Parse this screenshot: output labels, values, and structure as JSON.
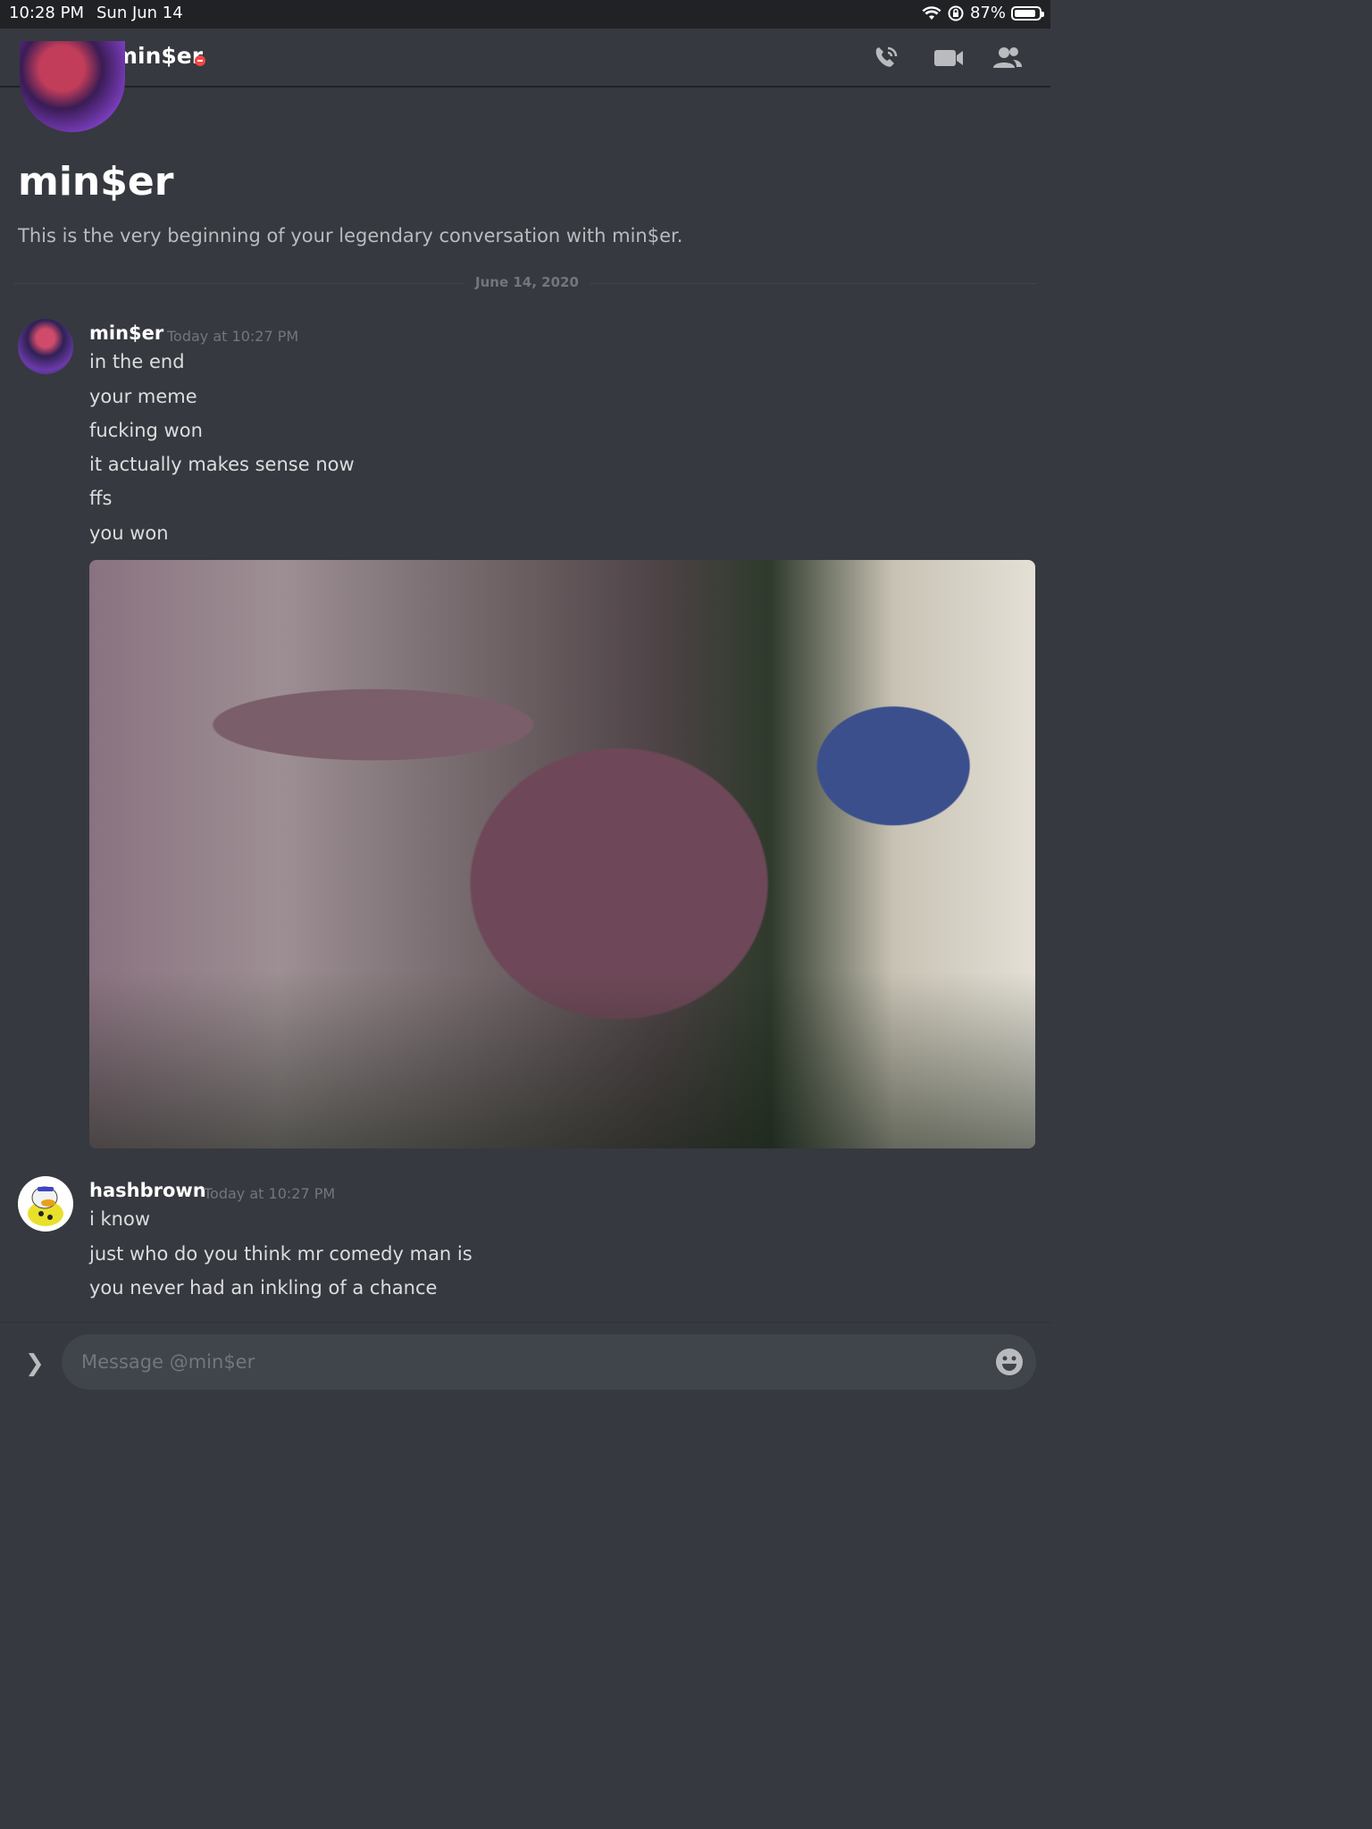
{
  "status_bar": {
    "time": "10:28 PM",
    "date": "Sun Jun 14",
    "battery": "87%",
    "battery_level": 0.87
  },
  "header": {
    "title": "min$er",
    "icons": [
      "menu-icon",
      "at-icon",
      "call-icon",
      "video-icon",
      "members-icon"
    ]
  },
  "intro": {
    "name": "min$er",
    "description": "This is the very beginning of your legendary conversation with min$er."
  },
  "date_divider": "June 14, 2020",
  "messages": [
    {
      "author": "min$er",
      "timestamp": "Today at 10:27 PM",
      "lines": [
        "in the end",
        "your meme",
        "fucking won",
        "it actually makes sense now",
        "ffs",
        "you won"
      ]
    },
    {
      "author": "hashbrown",
      "timestamp": "Today at 10:27 PM",
      "lines": [
        "i know",
        "just who do you think mr comedy man is",
        "you never had an inkling of a chance"
      ]
    }
  ],
  "composer": {
    "placeholder": "Message @min$er"
  },
  "colors": {
    "background": "#36393f",
    "dnd_status": "#f04747",
    "composer_bg": "#40444b"
  }
}
